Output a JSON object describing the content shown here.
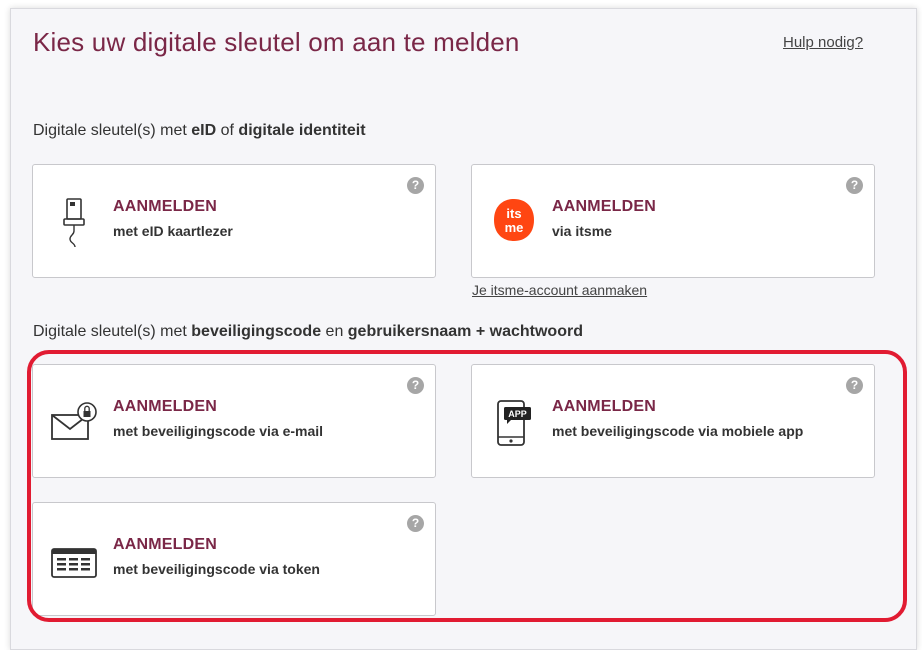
{
  "header": {
    "title": "Kies uw digitale sleutel om aan te melden",
    "help_link": "Hulp nodig?"
  },
  "section1": {
    "prefix": "Digitale sleutel(s) met ",
    "b1": "eID",
    "mid": " of ",
    "b2": "digitale identiteit"
  },
  "section2": {
    "prefix": "Digitale sleutel(s) met ",
    "b1": "beveiligingscode",
    "mid": " en ",
    "b2": "gebruikersnaam + wachtwoord"
  },
  "cards": [
    {
      "icon": "eid-card-reader-icon",
      "cta": "AANMELDEN",
      "sub": "met eID kaartlezer"
    },
    {
      "icon": "itsme-logo",
      "cta": "AANMELDEN",
      "sub": "via itsme",
      "logo_text_1": "its",
      "logo_text_2": "me"
    },
    {
      "icon": "email-lock-icon",
      "cta": "AANMELDEN",
      "sub": "met beveiligingscode via e-mail"
    },
    {
      "icon": "mobile-app-icon",
      "cta": "AANMELDEN",
      "sub": "met beveiligingscode via mobiele app",
      "badge": "APP"
    },
    {
      "icon": "token-icon",
      "cta": "AANMELDEN",
      "sub": "met beveiligingscode via token"
    }
  ],
  "itsme_account_link": "Je itsme-account aanmaken",
  "help_icon_glyph": "?",
  "colors": {
    "accent": "#7a2747",
    "itsme": "#ff4612",
    "highlight": "#e11b32"
  }
}
